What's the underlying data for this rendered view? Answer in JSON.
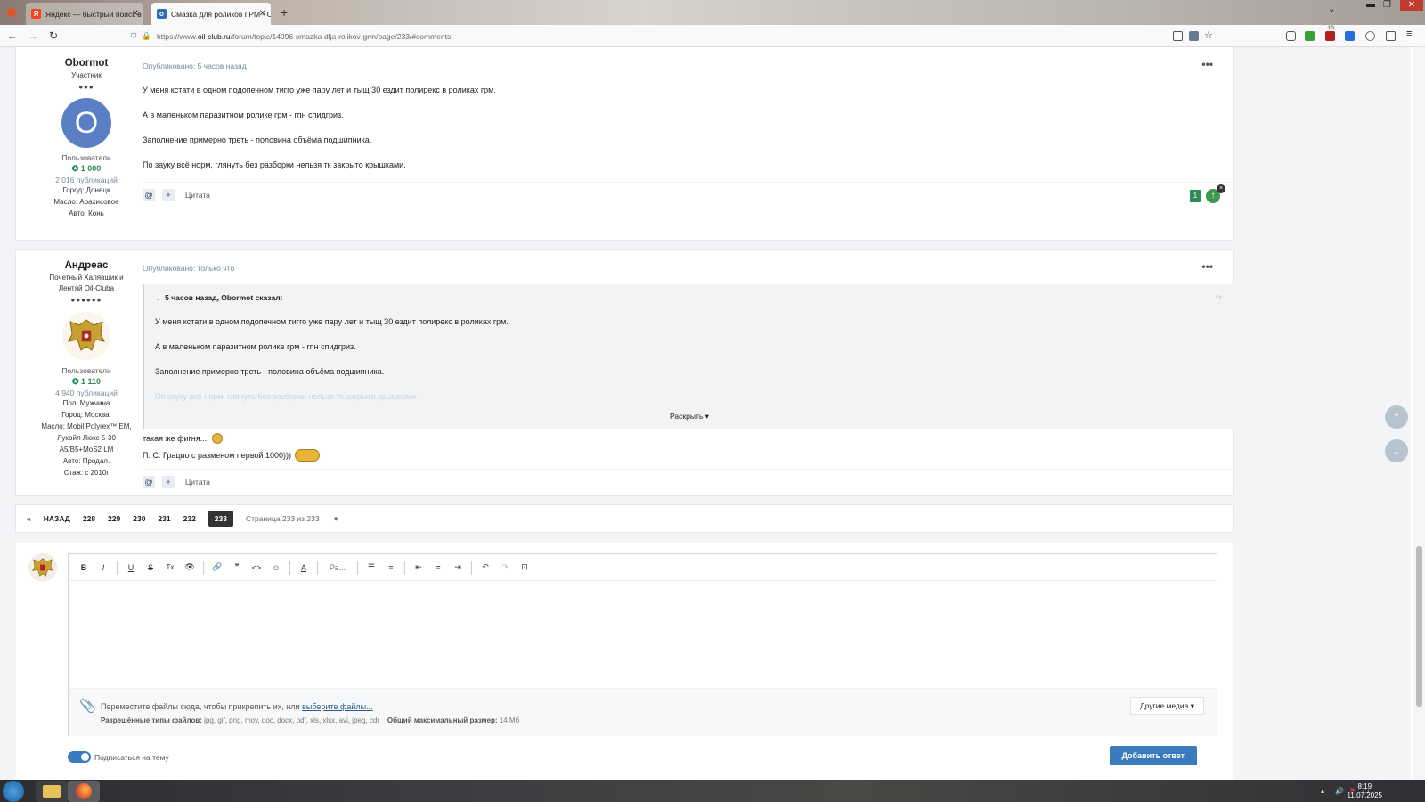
{
  "browser": {
    "tabs": [
      {
        "title": "Яндекс — быстрый поиск в ин",
        "icon": "yandex-icon",
        "active": false
      },
      {
        "title": "Смазка для роликов ГРМ - Ст",
        "icon": "oilclub-icon",
        "active": true
      }
    ],
    "url_prefix": "https://www.",
    "url_domain": "oil-club.ru",
    "url_path": "/forum/topic/14096-smazka-dlja-rolikov-grm/page/233/#comments",
    "ext_badge": "10"
  },
  "posts": [
    {
      "author": "Obormot",
      "rank": "Участник",
      "pips": "●●●",
      "avatar_letter": "O",
      "group": "Пользователи",
      "reputation": "1 000",
      "posts_count": "2 016 публикаций",
      "info": [
        "Город: Донецк",
        "Масло: Арахисовое",
        "Авто: Конь"
      ],
      "posted": "Опубликовано: 5 часов назад",
      "paragraphs": [
        "У меня кстати в одном подопечном тигго уже пару лет и тыщ 30 ездит полирекс в роликах грм.",
        "А в маленьком паразитном ролике грм - гпн спидгриз.",
        "Заполнение примерно треть - половина объёма подшипника.",
        "По зауку всё норм, глянуть без разборки нельзя тк закрыто крышками."
      ],
      "quote_label": "Цитата",
      "reaction_count": "1"
    },
    {
      "author": "Андреас",
      "rank_line1": "Почетный Халявщик и",
      "rank_line2": "Лентяй Oil-Cluba",
      "pips": "●●●●●●",
      "group": "Пользователи",
      "reputation": "1 110",
      "posts_count": "4 940 публикаций",
      "info": [
        "Пол: Мужчина",
        "Город: Москва.",
        "Масло: Mobil Polyrex™ EM,",
        "Лукойл Люкс 5-30",
        "A5/B5+MoS2 LM",
        "Авто: Продал.",
        "Стаж: с 2010г"
      ],
      "posted": "Опубликовано: только что",
      "quote_header": "5 часов назад, Obormot сказал:",
      "quote_lines": [
        "У меня кстати в одном подопечном тигго уже пару лет и тыщ 30 ездит полирекс в роликах грм.",
        "А в маленьком паразитном ролике грм - гпн спидгриз.",
        "Заполнение примерно треть - половина объёма подшипника.",
        "По зауку всё норм, глянуть без разборки нельзя тк закрыто крышками."
      ],
      "expand_label": "Раскрыть",
      "line1": "такая же фигня...",
      "line2": "П. С: Грацио с разменом первой 1000)))",
      "quote_label": "Цитата"
    }
  ],
  "pagination": {
    "first": "«",
    "prev": "НАЗАД",
    "pages": [
      "228",
      "229",
      "230",
      "231",
      "232"
    ],
    "current": "233",
    "total": "Страница 233 из 233"
  },
  "editor": {
    "toolbar": [
      "B",
      "I",
      "U",
      "S",
      "Tx",
      "👁",
      "🔗",
      "❞",
      "<>",
      "☺",
      "A",
      "Ра...",
      "☰",
      "≡",
      "⇤",
      "≡",
      "⇥",
      "↶",
      "↷",
      "⊡"
    ],
    "drop_text": "Переместите файлы сюда, чтобы прикрепить их, или ",
    "choose_files": "выберите файлы...",
    "types_label": "Разрешённые типы файлов:",
    "types": "jpg, gif, png, mov, doc, docx, pdf, xls, xlsx, avi, jpeg, cdr",
    "max_label": "Общий максимальный размер:",
    "max_size": "14 Мб",
    "other_media": "Другие медиа",
    "subscribe": "Подписаться на тему",
    "submit": "Добавить ответ"
  },
  "taskbar": {
    "time": "8:19",
    "date": "11.07.2025"
  }
}
